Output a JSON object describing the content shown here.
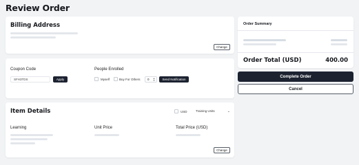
{
  "page": {
    "title": "Review Order"
  },
  "billing": {
    "title": "Billing Address",
    "change_label": "Change"
  },
  "coupon": {
    "label": "Coupon Code",
    "value": "SFH3TDS",
    "apply_label": "Apply"
  },
  "enrollment": {
    "label": "People Enrolled",
    "myself_label": "Myself",
    "others_label": "Buy For Others",
    "quantity": "0",
    "notify_label": "Send Notification"
  },
  "items": {
    "title": "Item Details",
    "currency_label": "USD",
    "units_select": "Training Units",
    "columns": [
      "Learning",
      "Unit Price",
      "Total Price (USD)"
    ],
    "change_label": "Change"
  },
  "summary": {
    "title": "Order Summary",
    "total_label": "Order Total (USD)",
    "total_value": "400.00",
    "complete_label": "Complete Order",
    "cancel_label": "Cancel"
  },
  "colors": {
    "background": "#f1f3f5",
    "card": "#ffffff",
    "primary_dark": "#1c2230",
    "placeholder": "#e3e7ec"
  },
  "icons": {
    "chevron": "chevron-down-icon",
    "stepper": "stepper-arrows-icon"
  }
}
